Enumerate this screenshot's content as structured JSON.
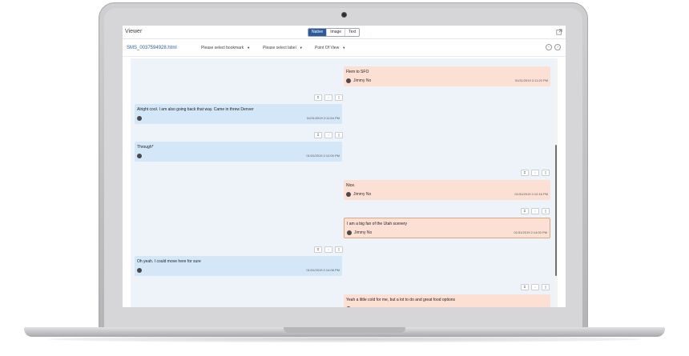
{
  "viewer": {
    "title": "Viewer",
    "tabs": [
      {
        "label": "Native",
        "active": true
      },
      {
        "label": "Image",
        "active": false
      },
      {
        "label": "Text",
        "active": false
      }
    ],
    "popout_icon": "external-link-icon"
  },
  "toolbar": {
    "file_name": "SMS_0037594928.html",
    "bookmark_placeholder": "Please select bookmark",
    "label_placeholder": "Please select label",
    "point_of_view": "Point Of View",
    "prev_icon": "chevron-left-icon",
    "next_icon": "chevron-right-icon"
  },
  "messages": [
    {
      "direction": "out",
      "text": "Flem to SFO",
      "sender": "Jimmy No",
      "time": "01/31/2019 2:11:20 PM"
    },
    {
      "direction": "in",
      "text": "Alright cool. I am also going back that way. Came in threw Denver",
      "sender": "",
      "time": "01/31/2019 2:11:54 PM"
    },
    {
      "direction": "in",
      "text": "Through*",
      "sender": "",
      "time": "01/31/2019 2:12:00 PM"
    },
    {
      "direction": "out",
      "text": "Nice.",
      "sender": "Jimmy No",
      "time": "01/31/2019 2:12:16 PM"
    },
    {
      "direction": "out",
      "text": "I am a big fan of the Utah scenery",
      "sender": "Jimmy No",
      "time": "01/31/2019 2:14:00 PM",
      "selected": true
    },
    {
      "direction": "in",
      "text": "Oh yeah. I could move here for sure",
      "sender": "",
      "time": "01/31/2019 2:14:08 PM"
    },
    {
      "direction": "out",
      "text": "Yeah a little cold for me, but a lot to do and great food options",
      "sender": "",
      "time": ""
    }
  ],
  "colors": {
    "incoming": "#d3e7f8",
    "outgoing": "#fde0d4",
    "accent": "#2e5a9a",
    "chat_bg": "#eef3fa"
  }
}
